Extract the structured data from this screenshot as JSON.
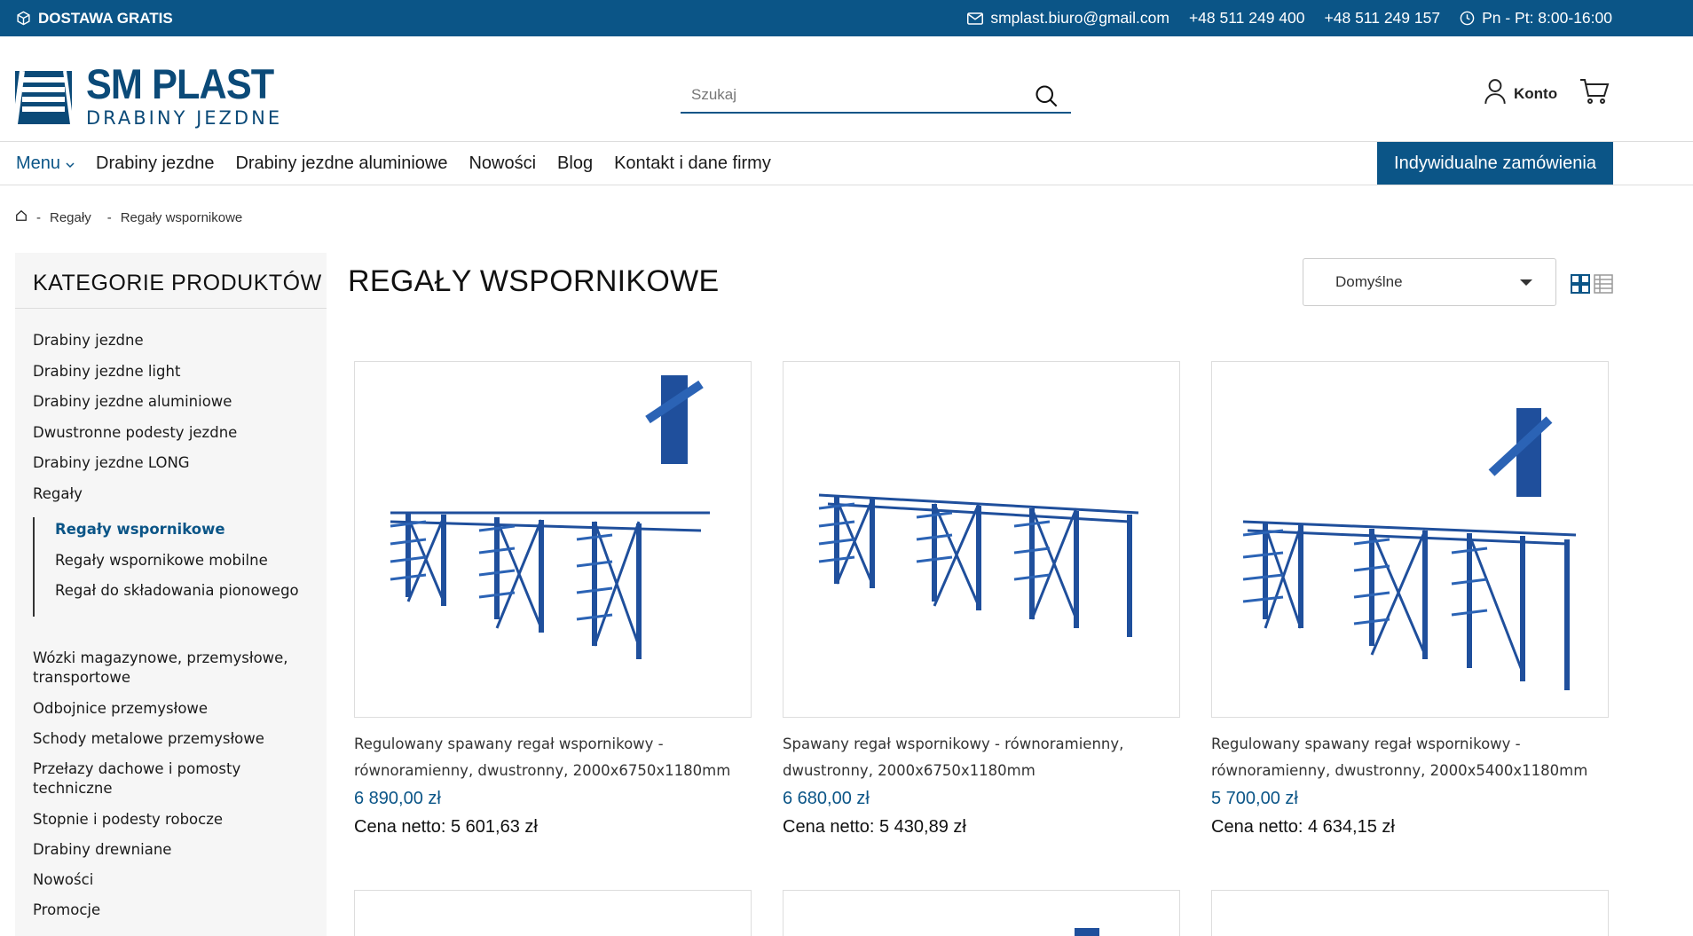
{
  "topbar": {
    "shipping": "DOSTAWA GRATIS",
    "email": "smplast.biuro@gmail.com",
    "phone1": "+48 511 249 400",
    "phone2": "+48 511 249 157",
    "hours": "Pn - Pt: 8:00-16:00"
  },
  "brand": {
    "name": "SM PLAST",
    "tagline": "DRABINY JEZDNE"
  },
  "search": {
    "placeholder": "Szukaj"
  },
  "account": {
    "label": "Konto"
  },
  "nav": {
    "menu": "Menu",
    "links": [
      "Drabiny jezdne",
      "Drabiny jezdne aluminiowe",
      "Nowości",
      "Blog",
      "Kontakt i dane firmy"
    ],
    "cta": "Indywidualne zamówienia"
  },
  "breadcrumb": {
    "sep": "-",
    "items": [
      "Regały",
      "Regały wspornikowe"
    ]
  },
  "sidebar": {
    "title": "KATEGORIE PRODUKTÓW",
    "categories": [
      "Drabiny jezdne",
      "Drabiny jezdne light",
      "Drabiny jezdne aluminiowe",
      "Dwustronne podesty jezdne",
      "Drabiny jezdne LONG",
      "Regały",
      "Wózki magazynowe, przemysłowe, transportowe",
      "Odbojnice przemysłowe",
      "Schody metalowe przemysłowe",
      "Przełazy dachowe i pomosty techniczne",
      "Stopnie i podesty robocze",
      "Drabiny drewniane",
      "Nowości",
      "Promocje"
    ],
    "subcategories": [
      "Regały wspornikowe",
      "Regały wspornikowe mobilne",
      "Regał do składowania pionowego"
    ]
  },
  "main": {
    "title": "REGAŁY WSPORNIKOWE",
    "sort": "Domyślne"
  },
  "products": [
    {
      "name": "Regulowany spawany regał wspornikowy - równoramienny, dwustronny, 2000x6750x1180mm",
      "price": "6 890,00 zł",
      "net": "Cena netto: 5 601,63 zł"
    },
    {
      "name": "Spawany regał wspornikowy - równoramienny, dwustronny, 2000x6750x1180mm",
      "price": "6 680,00 zł",
      "net": "Cena netto: 5 430,89 zł"
    },
    {
      "name": "Regulowany spawany regał wspornikowy - równoramienny, dwustronny, 2000x5400x1180mm",
      "price": "5 700,00 zł",
      "net": "Cena netto: 4 634,15 zł"
    }
  ],
  "colors": {
    "primary": "#0b5587",
    "rack": "#1f4f9c"
  }
}
